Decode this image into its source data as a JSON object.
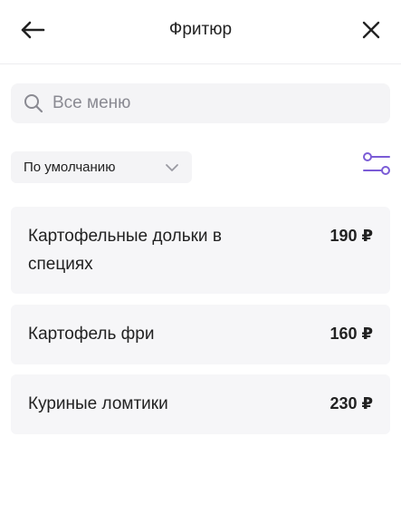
{
  "header": {
    "title": "Фритюр",
    "back_icon": "arrow-left-icon",
    "close_icon": "close-icon"
  },
  "search": {
    "placeholder": "Все меню",
    "value": "",
    "icon": "search-icon"
  },
  "sort": {
    "selected": "По умолчанию",
    "icon": "chevron-down-icon"
  },
  "filter": {
    "icon": "filter-sliders-icon",
    "accent_color": "#7b5cd6"
  },
  "items": [
    {
      "name": "Картофельные дольки в специях",
      "price": "190 ₽"
    },
    {
      "name": "Картофель фри",
      "price": "160 ₽"
    },
    {
      "name": "Куриные ломтики",
      "price": "230 ₽"
    }
  ]
}
